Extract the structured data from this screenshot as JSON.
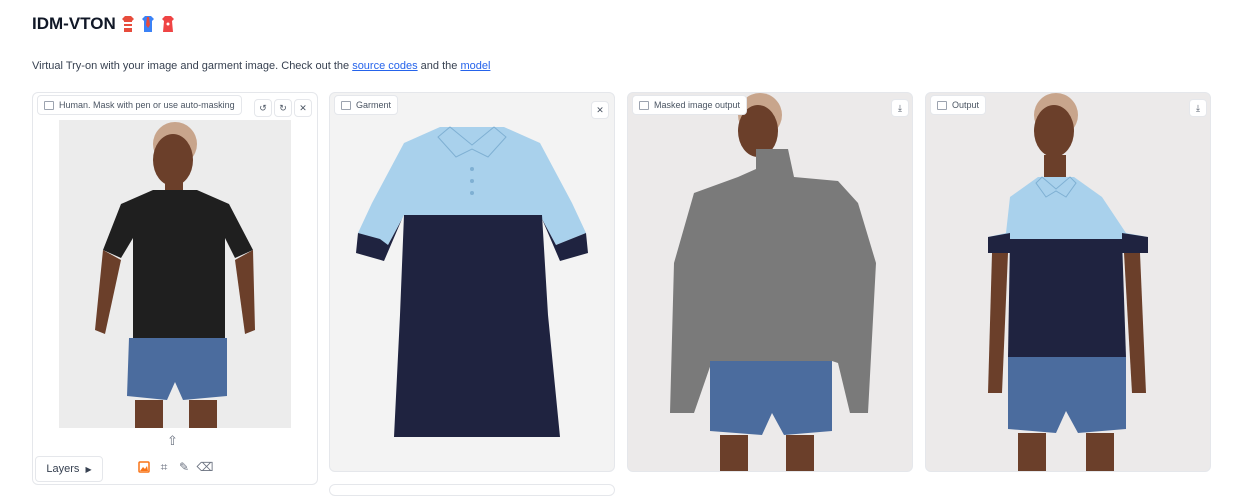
{
  "header": {
    "title": "IDM-VTON",
    "emoji_icons": [
      "shirt-icon",
      "necktie-shirt-icon",
      "dress-icon"
    ]
  },
  "subtitle": {
    "text": "Virtual Try-on with your image and garment image. Check out the ",
    "link1": "source codes",
    "mid": " and the ",
    "link2": "model"
  },
  "panels": {
    "human": {
      "label": "Human. Mask with pen or use auto-masking",
      "layers_label": "Layers"
    },
    "garment": {
      "label": "Garment"
    },
    "masked": {
      "label": "Masked image output"
    },
    "output": {
      "label": "Output"
    }
  },
  "colors": {
    "accent": "#f97316",
    "link": "#2563eb",
    "shirt_light_blue": "#a9d1ec",
    "shirt_navy": "#1f2340",
    "mask_gray": "#7a7a7a",
    "denim": "#4b6c9e"
  }
}
